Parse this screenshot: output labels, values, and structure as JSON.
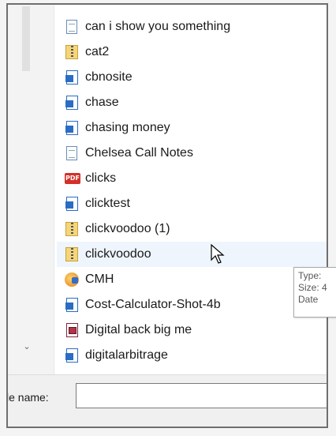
{
  "files": [
    {
      "name": "can i show you something",
      "icon": "text-document-icon"
    },
    {
      "name": "cat2",
      "icon": "zip-folder-icon"
    },
    {
      "name": "cbnosite",
      "icon": "word-document-icon"
    },
    {
      "name": "chase",
      "icon": "word-document-icon"
    },
    {
      "name": "chasing money",
      "icon": "word-document-icon"
    },
    {
      "name": "Chelsea Call Notes",
      "icon": "text-document-icon"
    },
    {
      "name": "clicks",
      "icon": "pdf-icon"
    },
    {
      "name": "clicktest",
      "icon": "word-document-icon"
    },
    {
      "name": "clickvoodoo (1)",
      "icon": "zip-folder-icon"
    },
    {
      "name": "clickvoodoo",
      "icon": "zip-folder-icon"
    },
    {
      "name": "CMH",
      "icon": "media-app-icon"
    },
    {
      "name": "Cost-Calculator-Shot-4b",
      "icon": "word-document-icon"
    },
    {
      "name": "Digital back big me",
      "icon": "image-document-icon"
    },
    {
      "name": "digitalarbitrage",
      "icon": "word-document-icon"
    }
  ],
  "hovered_index": 9,
  "tooltip": {
    "type": "Type:",
    "size": "Size: 4",
    "date": "Date"
  },
  "scroll": {
    "down_arrow": "⌄"
  },
  "filename": {
    "label": "le name:",
    "value": ""
  }
}
